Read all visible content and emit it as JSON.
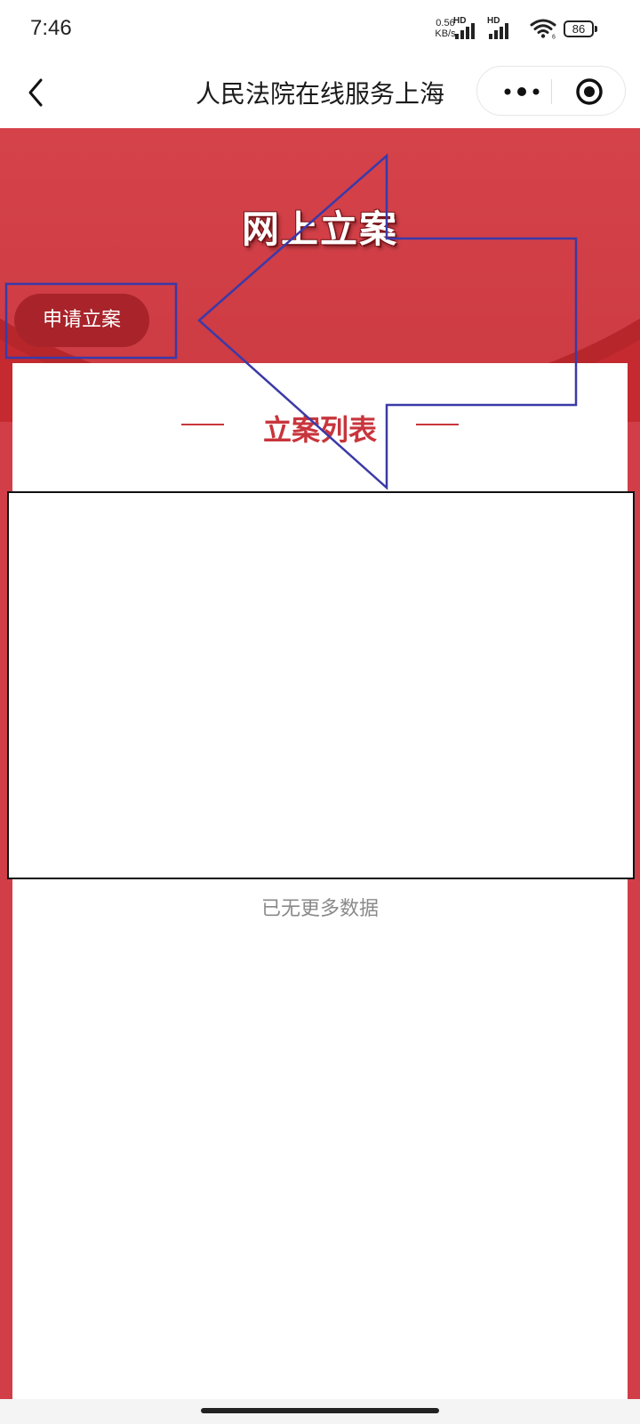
{
  "status_bar": {
    "time": "7:46",
    "net_speed_value": "0.56",
    "net_speed_unit": "KB/s",
    "signal_1_label": "HD",
    "signal_2_label": "HD",
    "wifi_label": "6",
    "battery": "86",
    "icons": [
      "signal-icon",
      "signal-icon",
      "wifi-icon",
      "battery-icon"
    ]
  },
  "nav": {
    "title": "人民法院在线服务上海",
    "icons": [
      "back-icon",
      "more-icon",
      "target-icon"
    ]
  },
  "banner": {
    "title": "网上立案"
  },
  "actions": {
    "apply_label": "申请立案"
  },
  "list": {
    "title": "立案列表",
    "empty_text": "已无更多数据"
  },
  "colors": {
    "brand_red": "#c42a2f",
    "title_red": "#c8353c",
    "button_red": "#a8242a",
    "annotation_blue": "#3a3aa8"
  }
}
